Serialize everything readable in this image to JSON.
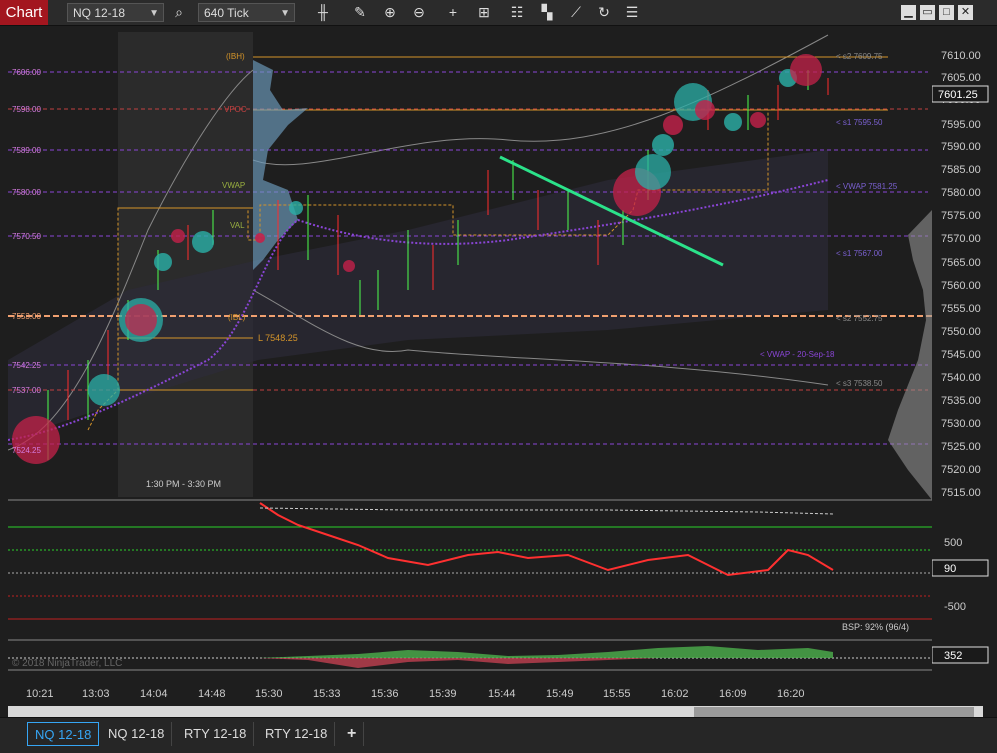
{
  "toolbar": {
    "chart_tab_label": "Chart",
    "instrument": "NQ 12-18",
    "interval": "640 Tick",
    "icons": [
      "bar-type-icon",
      "pencil-icon",
      "zoom-in-icon",
      "zoom-out-icon",
      "crosshair-icon",
      "data-box-icon",
      "strategy-icon",
      "indicator-icon",
      "drawing-tools-icon",
      "reload-icon",
      "properties-icon"
    ],
    "window_buttons": [
      "minimize",
      "restore",
      "maximize",
      "close"
    ]
  },
  "price_axis": {
    "ticks": [
      "7610.00",
      "7605.00",
      "7600.00",
      "7595.00",
      "7590.00",
      "7585.00",
      "7580.00",
      "7575.00",
      "7570.00",
      "7565.00",
      "7560.00",
      "7555.00",
      "7550.00",
      "7545.00",
      "7540.00",
      "7535.00",
      "7530.00",
      "7525.00",
      "7520.00",
      "7515.00"
    ],
    "current_price": "7601.25"
  },
  "left_price_labels": [
    "7606.00",
    "7598.00",
    "7589.00",
    "7580.00",
    "7570.50",
    "7553.00",
    "7542.25",
    "7537.00",
    "7524.25"
  ],
  "level_labels": {
    "ibh": "(IBH)",
    "vpoc": "VPOC",
    "vwap_left": "VWAP",
    "val": "VAL",
    "ibl": "(IBL)",
    "low_line": "L 7548.25",
    "s2_top": "< s2 7609.75",
    "s1_top": "< s1 7595.50",
    "vwap_right": "< VWAP 7581.25",
    "s1_bottom": "< s1 7567.00",
    "s2_bottom": "< s2 7552.75",
    "vwap_date": "< VWAP - 20-Sep-18",
    "s3_bottom": "< s3 7538.50"
  },
  "session_label": "1:30 PM - 3:30 PM",
  "indicator_panel": {
    "ticks": [
      "500",
      "0",
      "-500"
    ],
    "current_value": "90",
    "bsp_text": "BSP: 92% (96/4)"
  },
  "volume_panel": {
    "current_value": "352",
    "copyright": "© 2018 NinjaTrader, LLC"
  },
  "time_axis": [
    "10:21",
    "13:03",
    "14:04",
    "14:48",
    "15:30",
    "15:33",
    "15:36",
    "15:39",
    "15:44",
    "15:49",
    "15:55",
    "16:02",
    "16:09",
    "16:20"
  ],
  "bottom_tabs": [
    "NQ 12-18",
    "NQ 12-18",
    "RTY 12-18",
    "RTY 12-18"
  ],
  "add_tab_label": "+",
  "colors": {
    "chart_tab": "#a3161f",
    "up_bar": "#4cff4c",
    "down_bar": "#ff2c2c",
    "vwap": "#8a45d6",
    "ib_line": "#d4942a",
    "bubble_buy": "#2bb0a8",
    "bubble_sell": "#c4214a",
    "trendline": "#2be28a",
    "active_tab": "#36a6f5"
  }
}
